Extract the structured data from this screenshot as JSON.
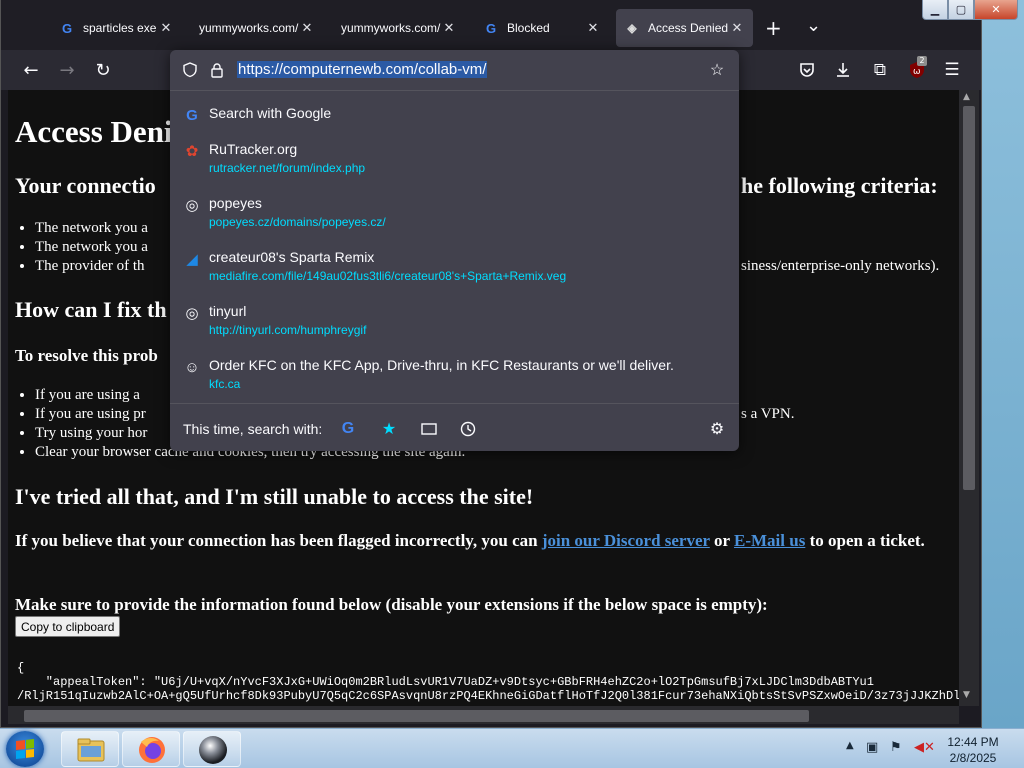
{
  "browser": {
    "tabs": [
      {
        "icon": "google-icon",
        "title": "sparticles exe d",
        "active": false
      },
      {
        "icon": "site-icon",
        "title": "yummyworks.com/",
        "active": false
      },
      {
        "icon": "site-icon",
        "title": "yummyworks.com/",
        "active": false
      },
      {
        "icon": "google-icon",
        "title": "Blocked",
        "active": false
      },
      {
        "icon": "access-denied-icon",
        "title": "Access Denied",
        "active": true
      }
    ],
    "new_tab": "+",
    "tab_list": "⌄",
    "url": "https://computernewb.com/collab-vm/",
    "extension_badge": "2"
  },
  "url_dropdown": {
    "suggestions": [
      {
        "icon": "google-search-icon",
        "title": "Search with Google",
        "url": ""
      },
      {
        "icon": "rutracker-icon",
        "title": "RuTracker.org",
        "url": "rutracker.net/forum/index.php"
      },
      {
        "icon": "globe-icon",
        "title": "popeyes",
        "url": "popeyes.cz/domains/popeyes.cz/"
      },
      {
        "icon": "mediafire-icon",
        "title": "createur08's Sparta Remix",
        "url": "mediafire.com/file/149au02fus3tli6/createur08's+Sparta+Remix.veg"
      },
      {
        "icon": "globe-icon",
        "title": "tinyurl",
        "url": "http://tinyurl.com/humphreygif"
      },
      {
        "icon": "kfc-icon",
        "title": "Order KFC on the KFC App, Drive-thru, in KFC Restaurants or we'll deliver.",
        "url": "kfc.ca"
      }
    ],
    "search_with_label": "This time, search with:"
  },
  "page": {
    "heading": "Access Deni",
    "connection_left": "Your connectio",
    "connection_right": "he following criteria:",
    "criteria": [
      {
        "left": "The network you a",
        "right": ""
      },
      {
        "left": "The network you a",
        "right": ""
      },
      {
        "left": "The provider of th",
        "right": "siness/enterprise-only networks)."
      }
    ],
    "fix_heading": "How can I fix th",
    "resolve_heading": "To resolve this prob",
    "steps": [
      {
        "left": "If you are using a",
        "right": ""
      },
      {
        "left": "If you are using pr",
        "right": "s a VPN."
      },
      {
        "left": "Try using your hor",
        "right": ""
      },
      {
        "left": "Clear your browser cache and cookies, then try accessing the site again.",
        "right": ""
      }
    ],
    "tried_heading": "I've tried all that, and I'm still unable to access the site!",
    "flagged_text_before": "If you believe that your connection has been flagged incorrectly, you can",
    "discord_link": "join our Discord server",
    "or_text": "or",
    "email_link": "E-Mail us",
    "flagged_text_after": "to open a ticket.",
    "provide_info": "Make sure to provide the information found below (disable your extensions if the below space is empty):",
    "copy_button": "Copy to clipboard",
    "code_line1": "{",
    "code_line2": "    \"appealToken\": \"U6j/U+vqX/nYvcF3XJxG+UWiOq0m2BRludLsvUR1V7UaDZ+v9Dtsyc+GBbFRH4ehZC2o+lO2TpGmsufBj7xLJDClm3DdbABTYu1",
    "code_line3": "/RljR151qIuzwb2AlC+OA+gQ5UfUrhcf8Dk93PubyU7Q5qC2c6SPAsvqnU8rzPQ4EKhneGiGDatflHoTfJ2Q0l381Fcur73ehaNXiQbtsStSvPSZxwOeiD/3z73jJJKZhDl"
  },
  "taskbar": {
    "time": "12:44 PM",
    "date": "2/8/2025",
    "apps": [
      "file-explorer-icon",
      "firefox-icon",
      "marble-app-icon"
    ]
  },
  "colors": {
    "page_bg": "#111111",
    "panel_bg": "#42414d",
    "link": "#4a90d9",
    "suggestion_url": "#00ddff"
  }
}
